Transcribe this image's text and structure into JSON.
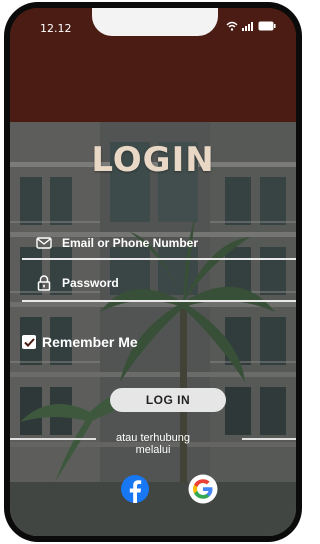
{
  "status_bar": {
    "time": "12.12"
  },
  "login": {
    "title": "LOGIN",
    "email_placeholder": "Email or Phone Number",
    "password_placeholder": "Password",
    "remember_label": "Remember Me",
    "remember_checked": true,
    "login_button": "LOG IN",
    "alt_line1": "atau terhubung",
    "alt_line2": "melalui"
  },
  "social": [
    {
      "name": "facebook",
      "icon": "facebook-icon",
      "color": "#1877f2"
    },
    {
      "name": "google",
      "icon": "google-icon",
      "colors": [
        "#ea4335",
        "#fbbc05",
        "#34a853",
        "#4285f4"
      ]
    }
  ],
  "colors": {
    "header": "#4a1c14",
    "title": "#ead8c6",
    "button_bg": "#e6e6e6"
  }
}
